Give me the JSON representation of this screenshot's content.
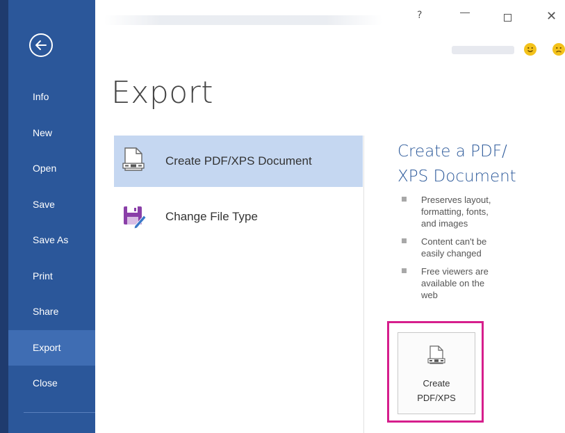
{
  "window": {
    "help": "?",
    "minimize": "—",
    "close": "✕"
  },
  "sidebar": {
    "items": [
      {
        "label": "Info"
      },
      {
        "label": "New"
      },
      {
        "label": "Open"
      },
      {
        "label": "Save"
      },
      {
        "label": "Save As"
      },
      {
        "label": "Print"
      },
      {
        "label": "Share"
      },
      {
        "label": "Export",
        "active": true
      },
      {
        "label": "Close"
      }
    ]
  },
  "page": {
    "title": "Export"
  },
  "options": [
    {
      "label": "Create PDF/XPS Document",
      "icon": "pdf-xps-document-icon",
      "selected": true
    },
    {
      "label": "Change File Type",
      "icon": "change-file-type-icon",
      "selected": false
    }
  ],
  "detail": {
    "heading_line1": "Create a PDF/",
    "heading_line2": "XPS Document",
    "bullets": [
      {
        "line1": "Preserves layout,",
        "line2": "formatting, fonts,",
        "line3": "and images"
      },
      {
        "line1": "Content can't be",
        "line2": "easily changed",
        "line3": ""
      },
      {
        "line1": "Free viewers are",
        "line2": "available on the",
        "line3": "web"
      }
    ],
    "button_line1": "Create",
    "button_line2": "PDF/XPS"
  },
  "colors": {
    "sidebar": "#2b579a",
    "sidebar_active": "#3f6db3",
    "selected_option": "#c5d7f1",
    "heading": "#2e5b9b",
    "highlight": "#d61e8c"
  }
}
